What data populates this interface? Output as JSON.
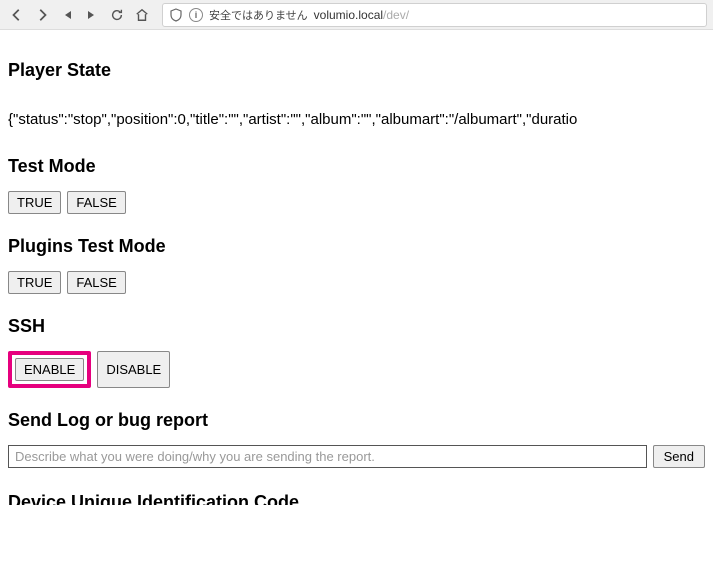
{
  "toolbar": {
    "security_warning": "安全ではありません",
    "url_host": "volumio.local",
    "url_path": "/dev/"
  },
  "sections": {
    "player_state": {
      "heading": "Player State",
      "json": "{\"status\":\"stop\",\"position\":0,\"title\":\"\",\"artist\":\"\",\"album\":\"\",\"albumart\":\"/albumart\",\"duratio"
    },
    "test_mode": {
      "heading": "Test Mode",
      "btn_true": "TRUE",
      "btn_false": "FALSE"
    },
    "plugins_test_mode": {
      "heading": "Plugins Test Mode",
      "btn_true": "TRUE",
      "btn_false": "FALSE"
    },
    "ssh": {
      "heading": "SSH",
      "btn_enable": "ENABLE",
      "btn_disable": "DISABLE"
    },
    "send_log": {
      "heading": "Send Log or bug report",
      "placeholder": "Describe what you were doing/why you are sending the report.",
      "btn_send": "Send"
    },
    "device_id": {
      "heading": "Device Unique Identification Code"
    }
  }
}
